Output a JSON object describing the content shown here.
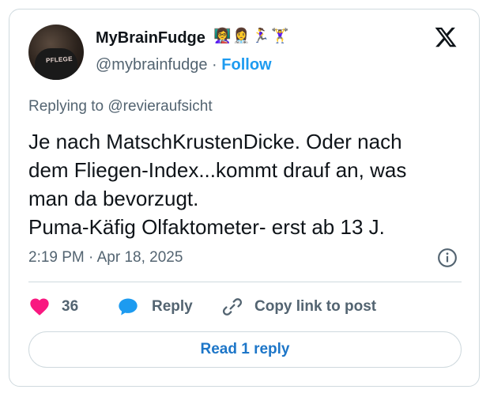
{
  "author": {
    "display_name": "MyBrainFudge",
    "emoji": "👩‍🏫👩‍⚕️🏃‍♀️🏋️‍♀️",
    "handle": "@mybrainfudge",
    "separator": "·",
    "follow_label": "Follow",
    "avatar_shirt_text": "PFLEGE"
  },
  "reply_context": "Replying to @revieraufsicht",
  "tweet": {
    "lines": [
      "Je nach MatschKrustenDicke. Oder nach",
      "dem Fliegen-Index...kommt drauf an, was",
      "man da bevorzugt.",
      "Puma-Käfig Olfaktometer- erst ab 13 J."
    ],
    "timestamp": "2:19 PM · Apr 18, 2025"
  },
  "actions": {
    "like_count": "36",
    "reply_label": "Reply",
    "copy_link_label": "Copy link to post"
  },
  "read_replies_label": "Read 1 reply",
  "colors": {
    "brand_blue": "#1d9bf0",
    "heart": "#f91880",
    "text_primary": "#0f1419",
    "text_secondary": "#536471",
    "border": "#cfd9de"
  },
  "icons": {
    "logo": "x-logo-icon",
    "info": "info-icon",
    "like": "heart-icon",
    "reply": "speech-bubble-icon",
    "copy": "link-icon"
  }
}
